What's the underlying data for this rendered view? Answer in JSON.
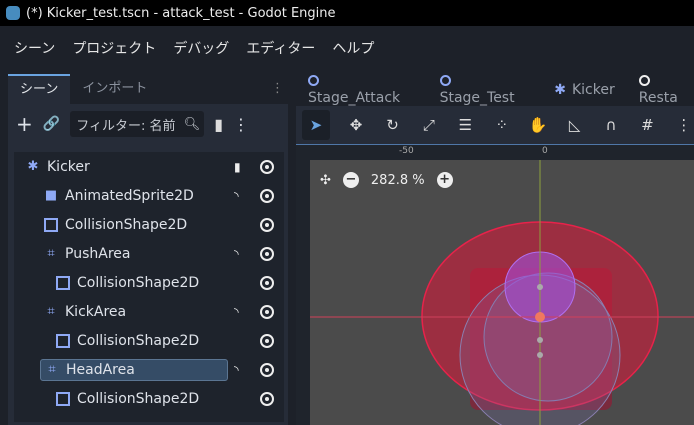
{
  "window": {
    "title": "(*) Kicker_test.tscn - attack_test - Godot Engine"
  },
  "menu": [
    "シーン",
    "プロジェクト",
    "デバッグ",
    "エディター",
    "ヘルプ"
  ],
  "left_tabs": [
    "シーン",
    "インポート"
  ],
  "filter": {
    "placeholder": "フィルター: 名前"
  },
  "tree": [
    {
      "name": "Kicker",
      "icon": "character-icon",
      "depth": 0,
      "signal": false,
      "script": true
    },
    {
      "name": "AnimatedSprite2D",
      "icon": "sprite-icon",
      "depth": 1,
      "signal": true
    },
    {
      "name": "CollisionShape2D",
      "icon": "shape-icon",
      "depth": 1,
      "signal": false
    },
    {
      "name": "PushArea",
      "icon": "area-icon",
      "depth": 1,
      "signal": true
    },
    {
      "name": "CollisionShape2D",
      "icon": "shape-icon",
      "depth": 2,
      "signal": false
    },
    {
      "name": "KickArea",
      "icon": "area-icon",
      "depth": 1,
      "signal": true
    },
    {
      "name": "CollisionShape2D",
      "icon": "shape-icon",
      "depth": 2,
      "signal": false
    },
    {
      "name": "HeadArea",
      "icon": "area-icon",
      "depth": 1,
      "signal": true,
      "selected": true
    },
    {
      "name": "CollisionShape2D",
      "icon": "shape-icon",
      "depth": 2,
      "signal": false
    }
  ],
  "scene_tabs": [
    "Stage_Attack",
    "Stage_Test",
    "Kicker",
    "Resta"
  ],
  "ruler": {
    "labels": [
      "-50",
      "0"
    ]
  },
  "zoom": {
    "level": "282.8 %"
  }
}
